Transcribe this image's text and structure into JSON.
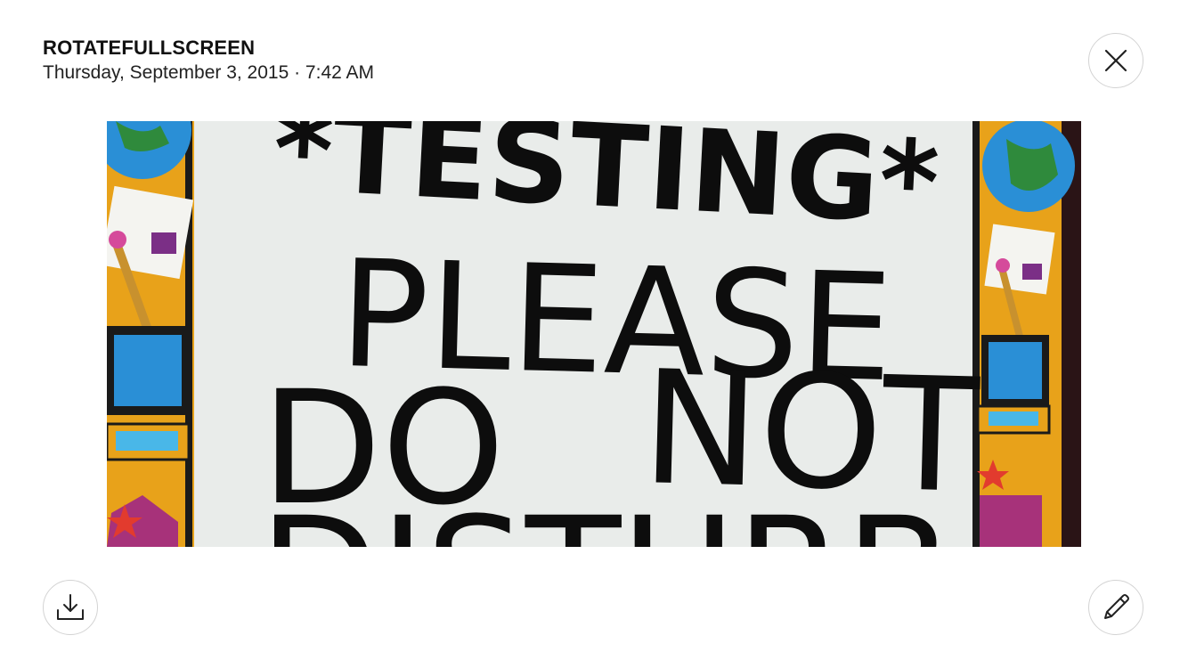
{
  "header": {
    "title": "ROTATEFULLSCREEN",
    "subtitle": "Thursday, September 3, 2015 · 7:42 AM"
  },
  "buttons": {
    "close_icon": "close-icon",
    "download_icon": "download-icon",
    "edit_icon": "pencil-icon"
  },
  "photo": {
    "sign_line_1": "*TESTING*",
    "sign_line_2": "PLEASE",
    "sign_line_3_left": "DO",
    "sign_line_3_right": "NOT",
    "sign_line_4": "DISTURB"
  },
  "colors": {
    "background": "#ffffff",
    "button_border": "#d3d3d3",
    "icon_stroke": "#222222",
    "sign_paper": "#e9ecea",
    "border_orange": "#e8a21a",
    "border_blue": "#2a8fd6",
    "border_green": "#2f8a3c",
    "border_purple": "#7b2f86"
  }
}
